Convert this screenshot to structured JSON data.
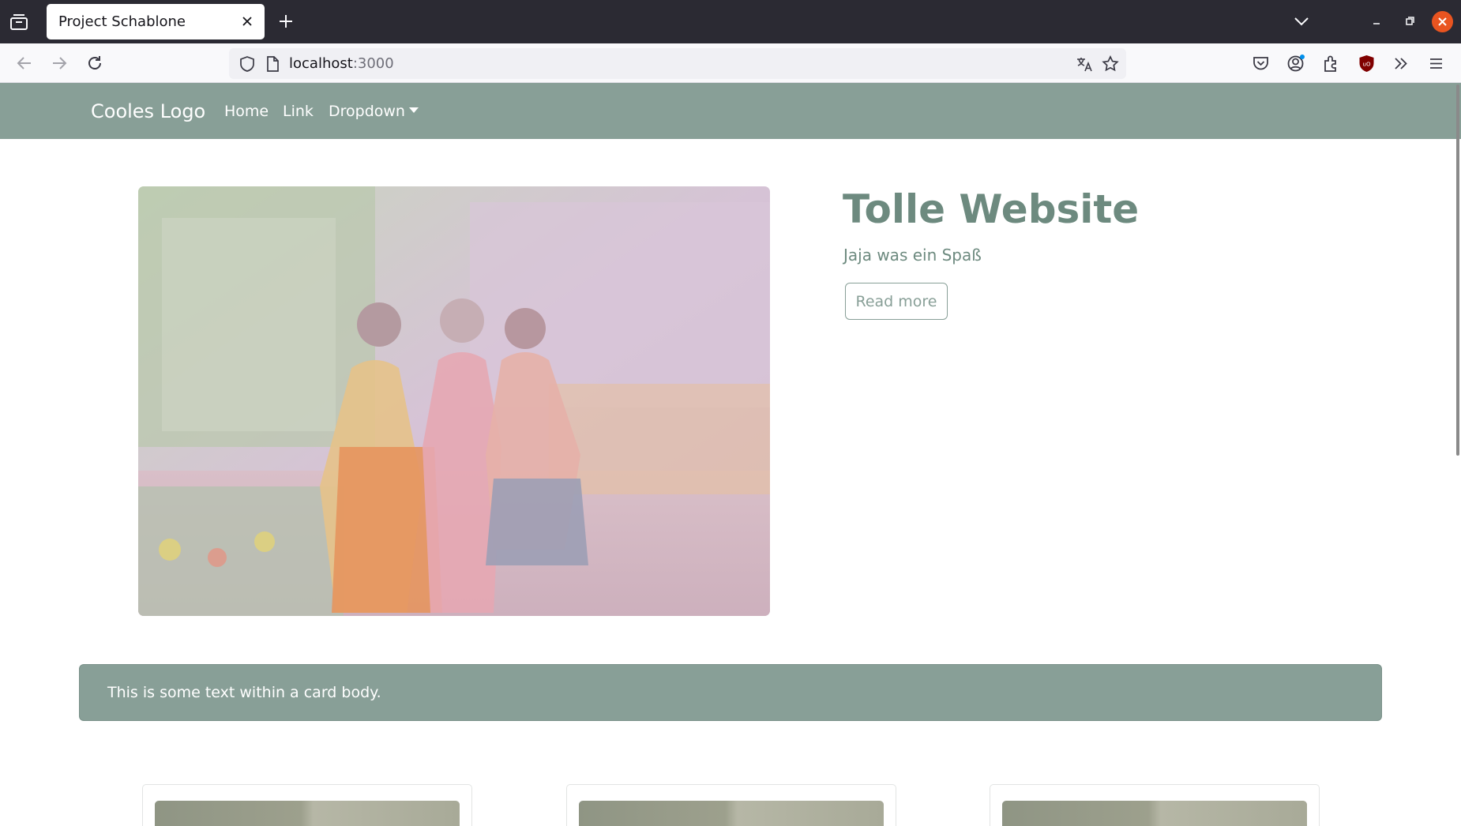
{
  "browser": {
    "tab": {
      "title": "Project Schablone"
    },
    "url": {
      "host": "localhost",
      "port": ":3000"
    }
  },
  "site": {
    "nav": {
      "brand": "Cooles Logo",
      "links": [
        "Home",
        "Link"
      ],
      "dropdown": "Dropdown"
    },
    "hero": {
      "title": "Tolle Website",
      "subtitle": "Jaja was ein Spaß",
      "button": "Read more"
    },
    "card": {
      "text": "This is some text within a card body."
    }
  },
  "colors": {
    "brand": "#889f97",
    "hero_text": "#6d8a7f",
    "tabbar": "#2b2a33",
    "window_close": "#e95420"
  },
  "icons": [
    "tab-list-icon",
    "close-icon",
    "plus-icon",
    "chevron-down-icon",
    "minimize-icon",
    "restore-icon",
    "back-arrow-icon",
    "forward-arrow-icon",
    "reload-icon",
    "shield-icon",
    "page-icon",
    "translate-icon",
    "star-icon",
    "pocket-icon",
    "account-icon",
    "extensions-icon",
    "ublock-icon",
    "overflow-icon",
    "menu-icon"
  ]
}
